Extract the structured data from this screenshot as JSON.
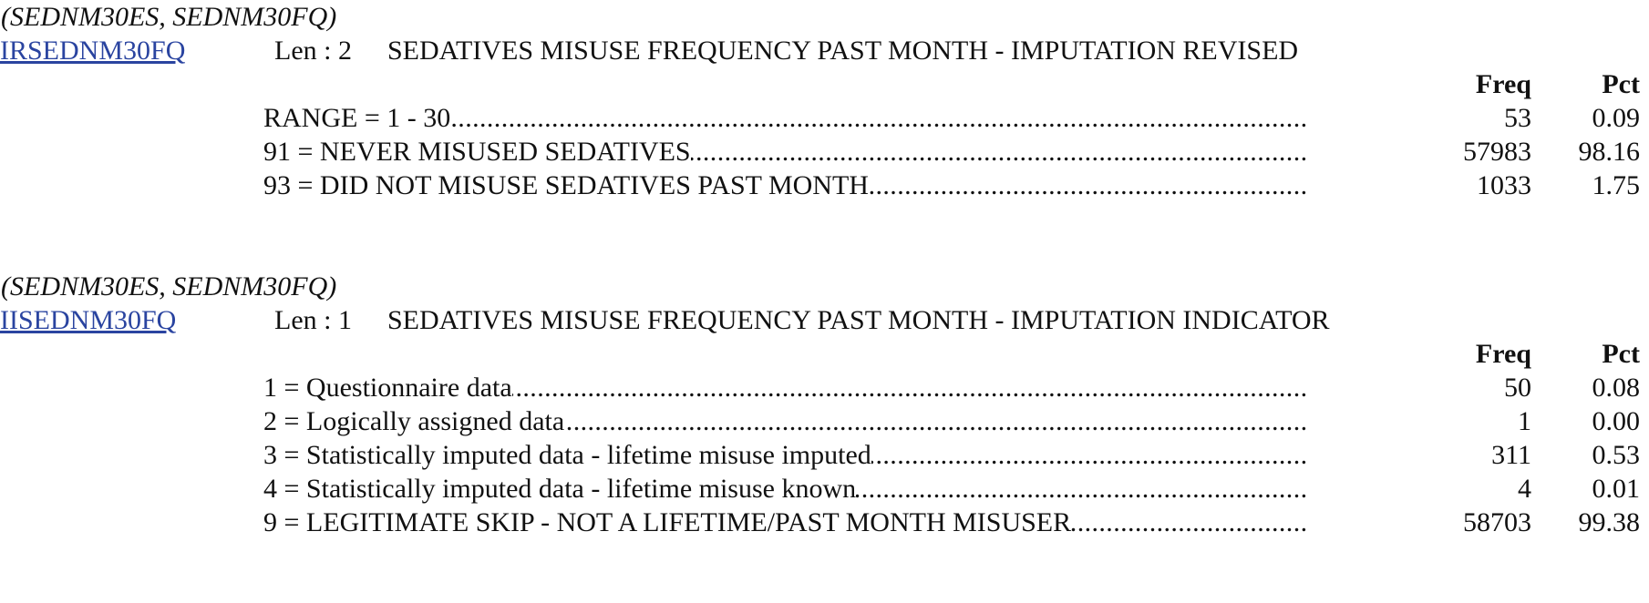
{
  "header_labels": {
    "freq": "Freq",
    "pct": "Pct"
  },
  "entries": [
    {
      "source": "(SEDNM30ES, SEDNM30FQ)",
      "varname": "IRSEDNM30FQ",
      "len": "Len : 2",
      "label": "SEDATIVES MISUSE FREQUENCY PAST MONTH - IMPUTATION REVISED",
      "rows": [
        {
          "desc": "RANGE = 1 - 30",
          "freq": "53",
          "pct": "0.09"
        },
        {
          "desc": "91 = NEVER MISUSED SEDATIVES",
          "freq": "57983",
          "pct": "98.16"
        },
        {
          "desc": "93 = DID NOT MISUSE SEDATIVES PAST MONTH",
          "freq": "1033",
          "pct": "1.75"
        }
      ]
    },
    {
      "source": "(SEDNM30ES, SEDNM30FQ)",
      "varname": "IISEDNM30FQ",
      "len": "Len : 1",
      "label": "SEDATIVES MISUSE FREQUENCY PAST MONTH - IMPUTATION INDICATOR",
      "rows": [
        {
          "desc": "1 = Questionnaire data",
          "freq": "50",
          "pct": "0.08"
        },
        {
          "desc": "2 = Logically assigned data",
          "freq": "1",
          "pct": "0.00"
        },
        {
          "desc": "3 = Statistically imputed data - lifetime misuse imputed",
          "freq": "311",
          "pct": "0.53"
        },
        {
          "desc": "4 = Statistically imputed data - lifetime misuse known",
          "freq": "4",
          "pct": "0.01"
        },
        {
          "desc": "9 = LEGITIMATE SKIP - NOT A LIFETIME/PAST MONTH MISUSER",
          "freq": "58703",
          "pct": "99.38"
        }
      ]
    }
  ]
}
